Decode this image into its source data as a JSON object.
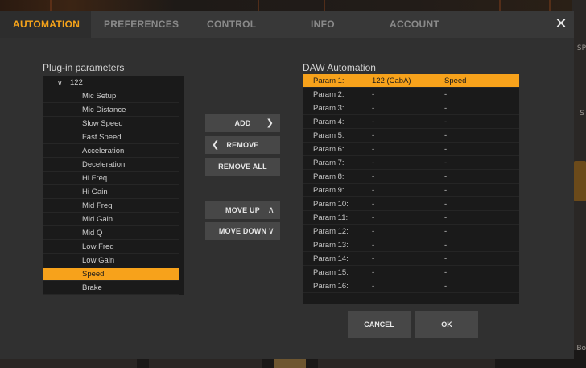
{
  "tabs": [
    {
      "label": "AUTOMATION",
      "active": true
    },
    {
      "label": "PREFERENCES",
      "active": false
    },
    {
      "label": "CONTROL",
      "active": false
    },
    {
      "label": "INFO",
      "active": false
    },
    {
      "label": "ACCOUNT",
      "active": false
    }
  ],
  "close_icon": "close-icon",
  "plugin_params": {
    "title": "Plug-in parameters",
    "group": "122",
    "items": [
      "Mic Setup",
      "Mic Distance",
      "Slow Speed",
      "Fast Speed",
      "Acceleration",
      "Deceleration",
      "Hi Freq",
      "Hi Gain",
      "Mid Freq",
      "Mid Gain",
      "Mid Q",
      "Low Freq",
      "Low Gain",
      "Speed",
      "Brake"
    ],
    "selected": "Speed"
  },
  "buttons": {
    "add": "ADD",
    "remove": "REMOVE",
    "remove_all": "REMOVE ALL",
    "move_up": "MOVE UP",
    "move_down": "MOVE DOWN"
  },
  "daw": {
    "title": "DAW Automation",
    "rows": [
      {
        "param": "Param 1:",
        "source": "122 (CabA)",
        "name": "Speed",
        "selected": true
      },
      {
        "param": "Param 2:",
        "source": "-",
        "name": "-"
      },
      {
        "param": "Param 3:",
        "source": "-",
        "name": "-"
      },
      {
        "param": "Param 4:",
        "source": "-",
        "name": "-"
      },
      {
        "param": "Param 5:",
        "source": "-",
        "name": "-"
      },
      {
        "param": "Param 6:",
        "source": "-",
        "name": "-"
      },
      {
        "param": "Param 7:",
        "source": "-",
        "name": "-"
      },
      {
        "param": "Param 8:",
        "source": "-",
        "name": "-"
      },
      {
        "param": "Param 9:",
        "source": "-",
        "name": "-"
      },
      {
        "param": "Param 10:",
        "source": "-",
        "name": "-"
      },
      {
        "param": "Param 11:",
        "source": "-",
        "name": "-"
      },
      {
        "param": "Param 12:",
        "source": "-",
        "name": "-"
      },
      {
        "param": "Param 13:",
        "source": "-",
        "name": "-"
      },
      {
        "param": "Param 14:",
        "source": "-",
        "name": "-"
      },
      {
        "param": "Param 15:",
        "source": "-",
        "name": "-"
      },
      {
        "param": "Param 16:",
        "source": "-",
        "name": "-"
      }
    ]
  },
  "footer": {
    "cancel": "CANCEL",
    "ok": "OK"
  },
  "background": {
    "side_text_1": "SP",
    "side_text_2": "S",
    "bottom_text": "Bo"
  },
  "colors": {
    "accent": "#f7a21b",
    "dialog_bg": "#303030",
    "list_bg": "#1a1a1a"
  }
}
